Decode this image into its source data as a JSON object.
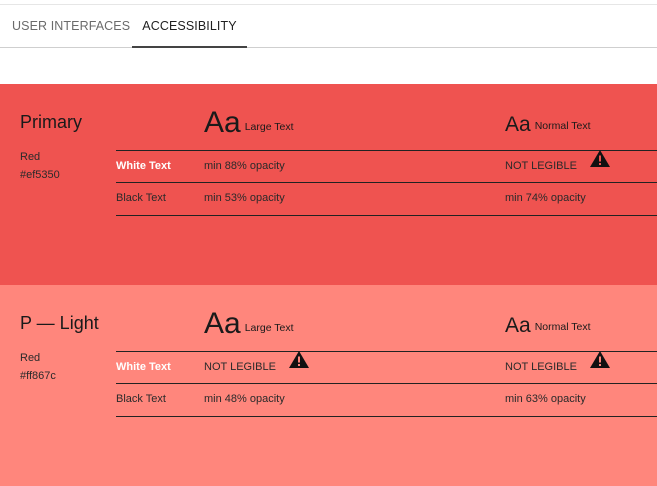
{
  "tabs": [
    {
      "label": "USER INTERFACES",
      "active": false
    },
    {
      "label": "ACCESSIBILITY",
      "active": true
    }
  ],
  "palettes": [
    {
      "name": "Primary",
      "color_name": "Red",
      "hex": "#ef5350",
      "bg": "#ef5350",
      "large_header": {
        "aa": "Aa",
        "label": "Large Text"
      },
      "normal_header": {
        "aa": "Aa",
        "label": "Normal Text"
      },
      "rows": [
        {
          "label": "White Text",
          "large": "min 88% opacity",
          "normal": "NOT LEGIBLE",
          "large_warn": false,
          "normal_warn": true
        },
        {
          "label": "Black Text",
          "large": "min 53% opacity",
          "normal": "min 74% opacity",
          "large_warn": false,
          "normal_warn": false
        }
      ]
    },
    {
      "name": "P — Light",
      "color_name": "Red",
      "hex": "#ff867c",
      "bg": "#ff867c",
      "large_header": {
        "aa": "Aa",
        "label": "Large Text"
      },
      "normal_header": {
        "aa": "Aa",
        "label": "Normal Text"
      },
      "rows": [
        {
          "label": "White Text",
          "large": "NOT LEGIBLE",
          "normal": "NOT LEGIBLE",
          "large_warn": true,
          "normal_warn": true
        },
        {
          "label": "Black Text",
          "large": "min 48% opacity",
          "normal": "min 63% opacity",
          "large_warn": false,
          "normal_warn": false
        }
      ]
    }
  ],
  "icons": {
    "warning": "warning-icon"
  }
}
